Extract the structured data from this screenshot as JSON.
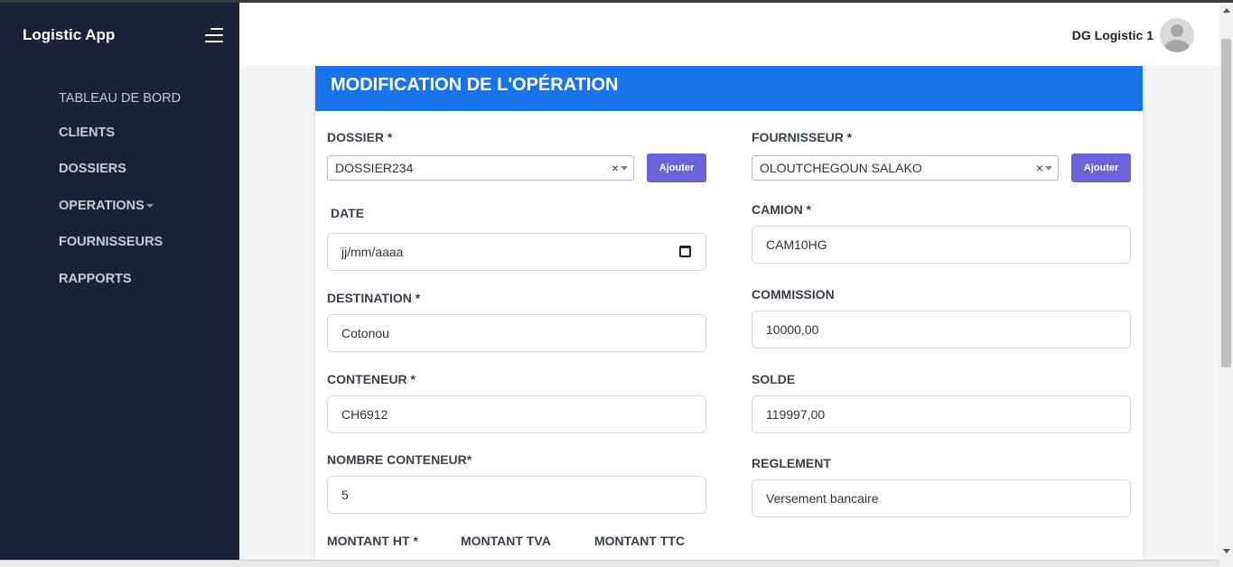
{
  "app": {
    "title": "Logistic App"
  },
  "sidebar": {
    "items": [
      {
        "label": "TABLEAU DE BORD"
      },
      {
        "label": "CLIENTS"
      },
      {
        "label": "DOSSIERS"
      },
      {
        "label": "OPERATIONS"
      },
      {
        "label": "FOURNISSEURS"
      },
      {
        "label": "RAPPORTS"
      }
    ]
  },
  "header": {
    "user_name": "DG Logistic 1"
  },
  "form": {
    "title": "MODIFICATION DE L'OPÉRATION",
    "add_button_label": "Ajouter",
    "dossier": {
      "label": "DOSSIER *",
      "value": "DOSSIER234",
      "clear": "×"
    },
    "fournisseur": {
      "label": "FOURNISSEUR *",
      "value": "OLOUTCHEGOUN SALAKO",
      "clear": "×"
    },
    "date": {
      "label": "DATE",
      "placeholder": "jj/mm/aaaa"
    },
    "camion": {
      "label": "CAMION *",
      "value": "CAM10HG"
    },
    "destination": {
      "label": "DESTINATION *",
      "value": "Cotonou"
    },
    "commission": {
      "label": "COMMISSION",
      "value": "10000,00"
    },
    "conteneur": {
      "label": "CONTENEUR *",
      "value": "CH6912"
    },
    "solde": {
      "label": "SOLDE",
      "value": "119997,00"
    },
    "nombre_conteneur": {
      "label": "NOMBRE CONTENEUR*",
      "value": "5"
    },
    "reglement": {
      "label": "REGLEMENT",
      "value": "Versement bancaire"
    },
    "montant_ht": {
      "label": "MONTANT HT *"
    },
    "montant_tva": {
      "label": "MONTANT TVA"
    },
    "montant_ttc": {
      "label": "MONTANT TTC"
    }
  }
}
